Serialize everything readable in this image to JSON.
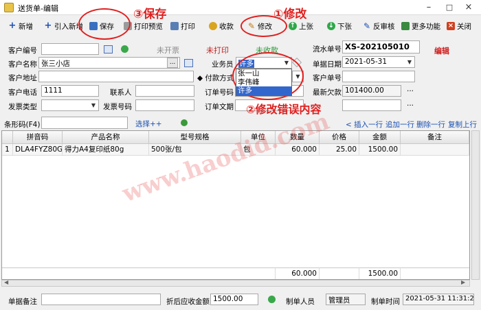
{
  "window": {
    "title": "送货单-编辑",
    "controls": {
      "minimize": "–",
      "maximize": "□",
      "close": "×"
    }
  },
  "toolbar": {
    "items": [
      {
        "label": "新增",
        "icon": "plus-icon"
      },
      {
        "label": "引入新增",
        "icon": "plus-icon"
      },
      {
        "label": "保存",
        "icon": "floppy-icon"
      },
      {
        "label": "打印预览",
        "icon": "print-preview-icon"
      },
      {
        "label": "打印",
        "icon": "printer-icon"
      },
      {
        "label": "收款",
        "icon": "money-icon"
      },
      {
        "label": "修改",
        "icon": "edit-icon"
      },
      {
        "label": "上张",
        "icon": "up-arrow-icon"
      },
      {
        "label": "下张",
        "icon": "down-arrow-icon"
      },
      {
        "label": "反审核",
        "icon": "unaudit-icon"
      },
      {
        "label": "更多功能",
        "icon": "more-icon"
      },
      {
        "label": "关闭",
        "icon": "close-icon"
      }
    ]
  },
  "status": {
    "invoice": "未开票",
    "print": "未打印",
    "payment": "未收款",
    "mode": "编辑"
  },
  "form": {
    "customer_code_label": "客户编号",
    "customer_code": "",
    "customer_name_label": "客户名称",
    "customer_name": "张三小店",
    "customer_address_label": "客户地址",
    "customer_address": "",
    "customer_phone_label": "客户电话",
    "customer_phone": "1111",
    "contact_label": "联系人",
    "contact": "",
    "invoice_type_label": "发票类型",
    "invoice_type": "",
    "invoice_no_label": "发票号码",
    "invoice_no": "",
    "salesperson_label": "业务员",
    "salesperson": "许多",
    "payment_method_label": "付款方式",
    "order_no_label": "订单号码",
    "order_text_label": "订单文期",
    "serial_no_label": "流水单号",
    "serial_no": "XS-202105010",
    "doc_date_label": "单据日期",
    "doc_date": "2021-05-31",
    "customer_doc_label": "客户单号",
    "customer_doc": "",
    "latest_debt_label": "最新欠款",
    "latest_debt": "101400.00",
    "ellipsis": "...",
    "salesperson_options": [
      "张一山",
      "李伟峰",
      "许多"
    ]
  },
  "barcode": {
    "label": "条形码(F4)",
    "value": "",
    "select_link": "选择++"
  },
  "row_actions": [
    "< 插入一行",
    "追加一行",
    "删除一行",
    "复制上行"
  ],
  "grid": {
    "headers": [
      "拼音码",
      "产品名称",
      "型号规格",
      "单位",
      "数量",
      "价格",
      "金额",
      "备注"
    ],
    "rows": [
      {
        "index": "1",
        "code": "DLA4FYZ80G",
        "name": "得力A4复印纸80g",
        "spec": "500张/包",
        "unit": "包",
        "qty": "60.000",
        "price": "25.00",
        "amount": "1500.00",
        "note": ""
      }
    ],
    "totals": {
      "qty": "60.000",
      "amount": "1500.00"
    }
  },
  "footer": {
    "remark_label": "单据备注",
    "remark": "",
    "discount_label": "折后应收金额",
    "discount_amount": "1500.00",
    "maker_label": "制单人员",
    "maker": "管理员",
    "make_time_label": "制单时间",
    "make_time": "2021-05-31 11:31:24"
  },
  "annotations": {
    "step1": "①修改",
    "step2": "②修改错误内容",
    "step3": "③保存"
  },
  "watermark": "www.haodid.com",
  "colors": {
    "annotation": "#e02020",
    "accent_blue": "#1a4fb0",
    "selected": "#3366cc"
  }
}
